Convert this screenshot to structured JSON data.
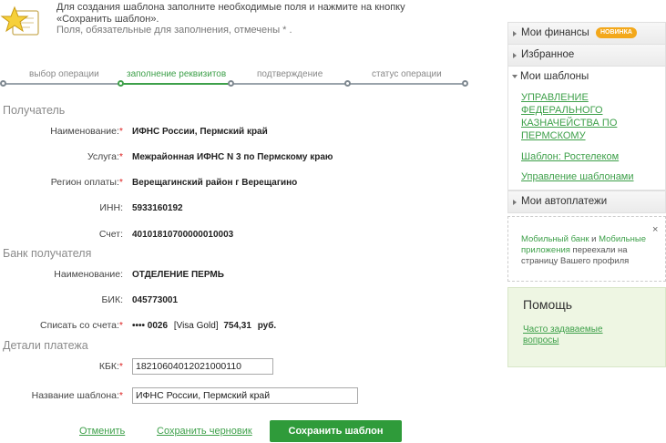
{
  "header": {
    "instruction": "Для создания шаблона заполните необходимые поля и нажмите на кнопку «Сохранить шаблон».",
    "required_note": "Поля, обязательные для заполнения, отмечены * ."
  },
  "steps": [
    "выбор операции",
    "заполнение реквизитов",
    "подтверждение",
    "статус операции"
  ],
  "steps_active_index": 1,
  "recipient": {
    "section": "Получатель",
    "name_label": "Наименование:",
    "name_value": "ИФНС России, Пермский край",
    "service_label": "Услуга:",
    "service_value": "Межрайонная ИФНС N 3 по Пермскому краю",
    "region_label": "Регион оплаты:",
    "region_value": "Верещагинский район г Верещагино",
    "inn_label": "ИНН:",
    "inn_value": "5933160192",
    "account_label": "Счет:",
    "account_value": "40101810700000010003"
  },
  "bank": {
    "section": "Банк получателя",
    "name_label": "Наименование:",
    "name_value": "ОТДЕЛЕНИЕ ПЕРМЬ",
    "bik_label": "БИК:",
    "bik_value": "045773001",
    "debit_label": "Списать со счета:",
    "card_number": "•••• 0026",
    "card_type": "[Visa Gold]",
    "card_balance": "754,31",
    "card_currency": "руб."
  },
  "payment": {
    "section": "Детали платежа",
    "kbk_label": "КБК:",
    "kbk_value": "18210604012021000110",
    "template_label": "Название шаблона:",
    "template_value": "ИФНС России, Пермский край"
  },
  "actions": {
    "cancel": "Отменить",
    "save_draft": "Сохранить черновик",
    "save_template": "Сохранить шаблон"
  },
  "sidebar": {
    "finances": "Мои финансы",
    "finances_badge": "НОВИНКА",
    "favorites": "Избранное",
    "templates": "Мои шаблоны",
    "template_links": [
      "УПРАВЛЕНИЕ ФЕДЕРАЛЬНОГО КАЗНАЧЕЙСТВА ПО ПЕРМСКОМУ",
      "Шаблон: Ростелеком",
      "Управление шаблонами"
    ],
    "autopayments": "Мои автоплатежи",
    "notice_link1": "Мобильный банк",
    "notice_and": " и ",
    "notice_link2": "Мобильные приложения",
    "notice_rest": " переехали на страницу Вашего профиля",
    "close": "×",
    "help_title": "Помощь",
    "faq": "Часто задаваемые вопросы"
  },
  "colors": {
    "accent": "#3ea04a",
    "button": "#2f9b3a",
    "badge": "#f3a81b",
    "required": "#dd2222"
  }
}
